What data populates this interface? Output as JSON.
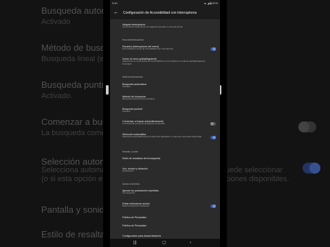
{
  "colors": {
    "accent": "#6b8ee8",
    "toggle_off": "#6f6f6f",
    "panel": "#2b2b2b",
    "bar": "#1c1c1c"
  },
  "background_left": {
    "rows": [
      {
        "label": "Busqueda automátic",
        "sub": "Activado"
      },
      {
        "label": "Método de busqueda",
        "sub": "Busqueda lineal (excep"
      },
      {
        "label": "Busqueda puntual",
        "sub": "Activado."
      },
      {
        "label": "Comenzar a buscar a",
        "sub": "La busqueda comenza"
      },
      {
        "label": "Selección automátic",
        "sub": "Selecciona automátic"
      },
      {
        "label": "",
        "sub": "(o si esta opción está"
      },
      {
        "label": "Pantalla y sonido",
        "sub": ""
      },
      {
        "label": "Estilo de resaltado de",
        "sub": ""
      }
    ]
  },
  "background_right": {
    "lines": [
      "puede seleccionar",
      "cciones disponibles."
    ]
  },
  "status_bar": {
    "time": "3:40",
    "icons": "▲ ◢ ▮ 81%"
  },
  "app_bar": {
    "back_icon": "arrow-back-icon",
    "title": "Configuración de Accesibilidad con Interruptores"
  },
  "list": {
    "items": [
      {
        "label": "Asignar interruptores",
        "sub": "Las acciones Seleccionar y/o siguiente acceden a una sola acción"
      },
      {
        "header": "Personalizar/desactivar"
      },
      {
        "label": "Escaneo (interruptores del menú)",
        "sub": "Personalizar el menú de Accesibilidad con interruptores",
        "toggle": true
      },
      {
        "label": "Volver al menú global/siguiente",
        "sub": "Seleccionar el menú global de Accesibilidad con interruptores a la última pantalla/siguiente interruptor",
        "toggle": null
      },
      {
        "header": "Parámetros/búsqueda"
      },
      {
        "label": "Búsqueda automática",
        "sub": "Activado"
      },
      {
        "label": "Método de búsqueda",
        "sub": "Búsqueda lineal (excepto teclados)"
      },
      {
        "label": "Búsqueda puntual",
        "sub": "Activado"
      },
      {
        "label": "Comenzar a buscar automáticamente",
        "sub": "La búsqueda comienza al aparecer la pantalla",
        "toggle": false
      },
      {
        "label": "Selección automática",
        "sub": "Selecciona automáticamente el elemento destacado, si solo hay una acción disponible",
        "toggle": true
      },
      {
        "header": "Pantalla y sonido"
      },
      {
        "label": "Estilo de resaltado de la búsqueda",
        "sub": ""
      },
      {
        "label": "Voz, sonido y vibración",
        "sub": "Desactivado"
      },
      {
        "header": "Ajustes avanzados"
      },
      {
        "label": "Ignorar los pulsaciones repetidas",
        "sub": "0,1 segundos"
      },
      {
        "label": "Evitar seleccionar acción",
        "sub": "Evitar la selección accidental",
        "toggle": true
      },
      {
        "label": "Política de Privacidad",
        "sub": ""
      },
      {
        "label": "Política de Privacidad",
        "sub": ""
      },
      {
        "label": "Configuración para desarrolladores",
        "sub": ""
      }
    ]
  },
  "nav_bar": {
    "recent_icon": "recents-icon",
    "home_icon": "home-icon",
    "back_icon": "nav-back-icon"
  }
}
